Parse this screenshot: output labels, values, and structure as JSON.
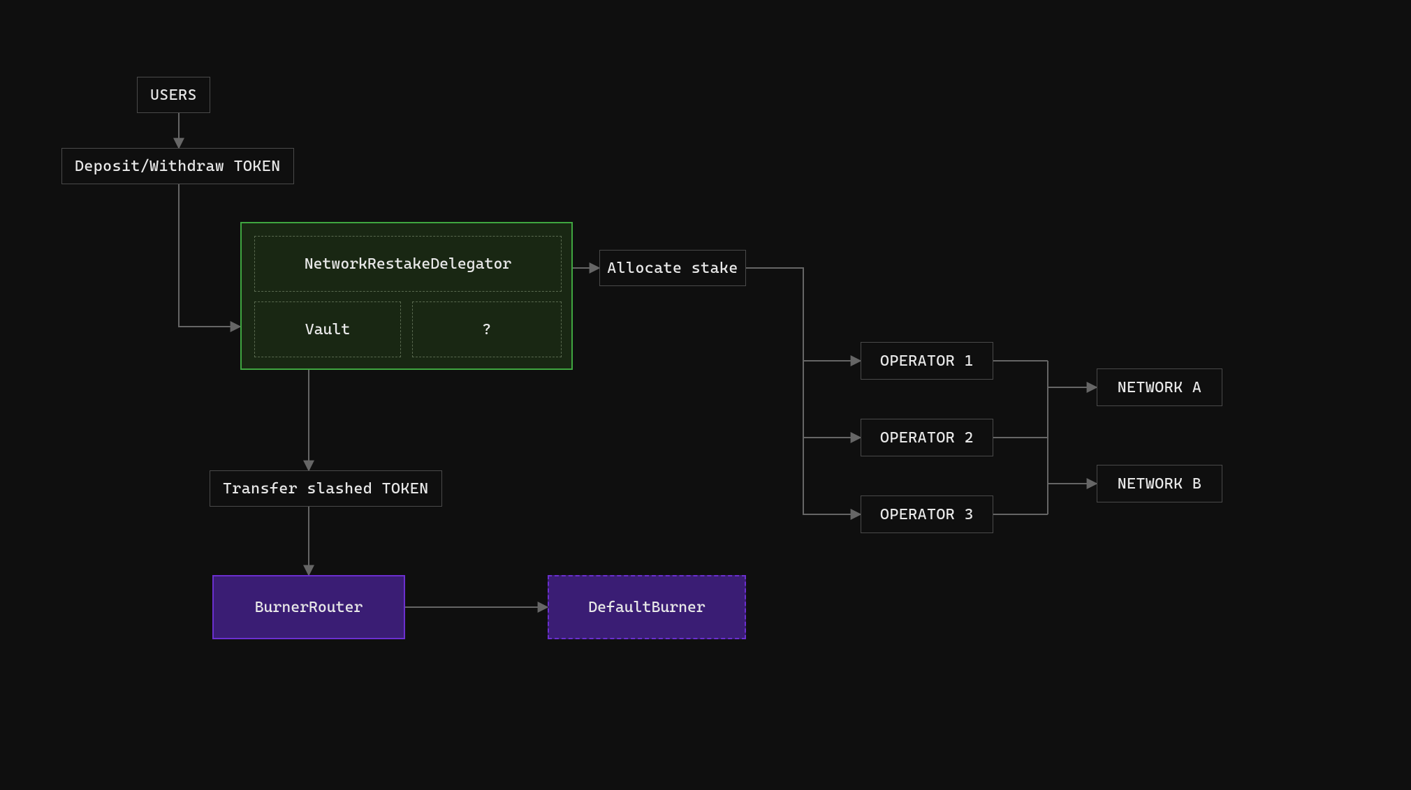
{
  "nodes": {
    "users": "USERS",
    "deposit_withdraw": "Deposit/Withdraw TOKEN",
    "delegator": "NetworkRestakeDelegator",
    "vault": "Vault",
    "unknown": "?",
    "allocate": "Allocate stake",
    "operator1": "OPERATOR 1",
    "operator2": "OPERATOR 2",
    "operator3": "OPERATOR 3",
    "networkA": "NETWORK A",
    "networkB": "NETWORK B",
    "transfer_slashed": "Transfer slashed TOKEN",
    "burner_router": "BurnerRouter",
    "default_burner": "DefaultBurner"
  },
  "colors": {
    "bg": "#0f0f0f",
    "line": "#666666",
    "box_border": "#4a4a4a",
    "green_border": "#3fa640",
    "green_fill_approx": "#213a18",
    "purple_border": "#6b2fcf",
    "purple_fill": "#3a1d74"
  },
  "diagram_edges": [
    {
      "from": "users",
      "to": "deposit_withdraw"
    },
    {
      "from": "deposit_withdraw",
      "to": "vault_group"
    },
    {
      "from": "vault_group",
      "to": "allocate"
    },
    {
      "from": "allocate",
      "to": "operator1"
    },
    {
      "from": "allocate",
      "to": "operator2"
    },
    {
      "from": "allocate",
      "to": "operator3"
    },
    {
      "from": "operator1",
      "to": "networkA"
    },
    {
      "from": "operator2",
      "to": "networkB"
    },
    {
      "from": "operator3",
      "to": "networkB"
    },
    {
      "from": "vault",
      "to": "transfer_slashed"
    },
    {
      "from": "transfer_slashed",
      "to": "burner_router"
    },
    {
      "from": "burner_router",
      "to": "default_burner"
    }
  ]
}
